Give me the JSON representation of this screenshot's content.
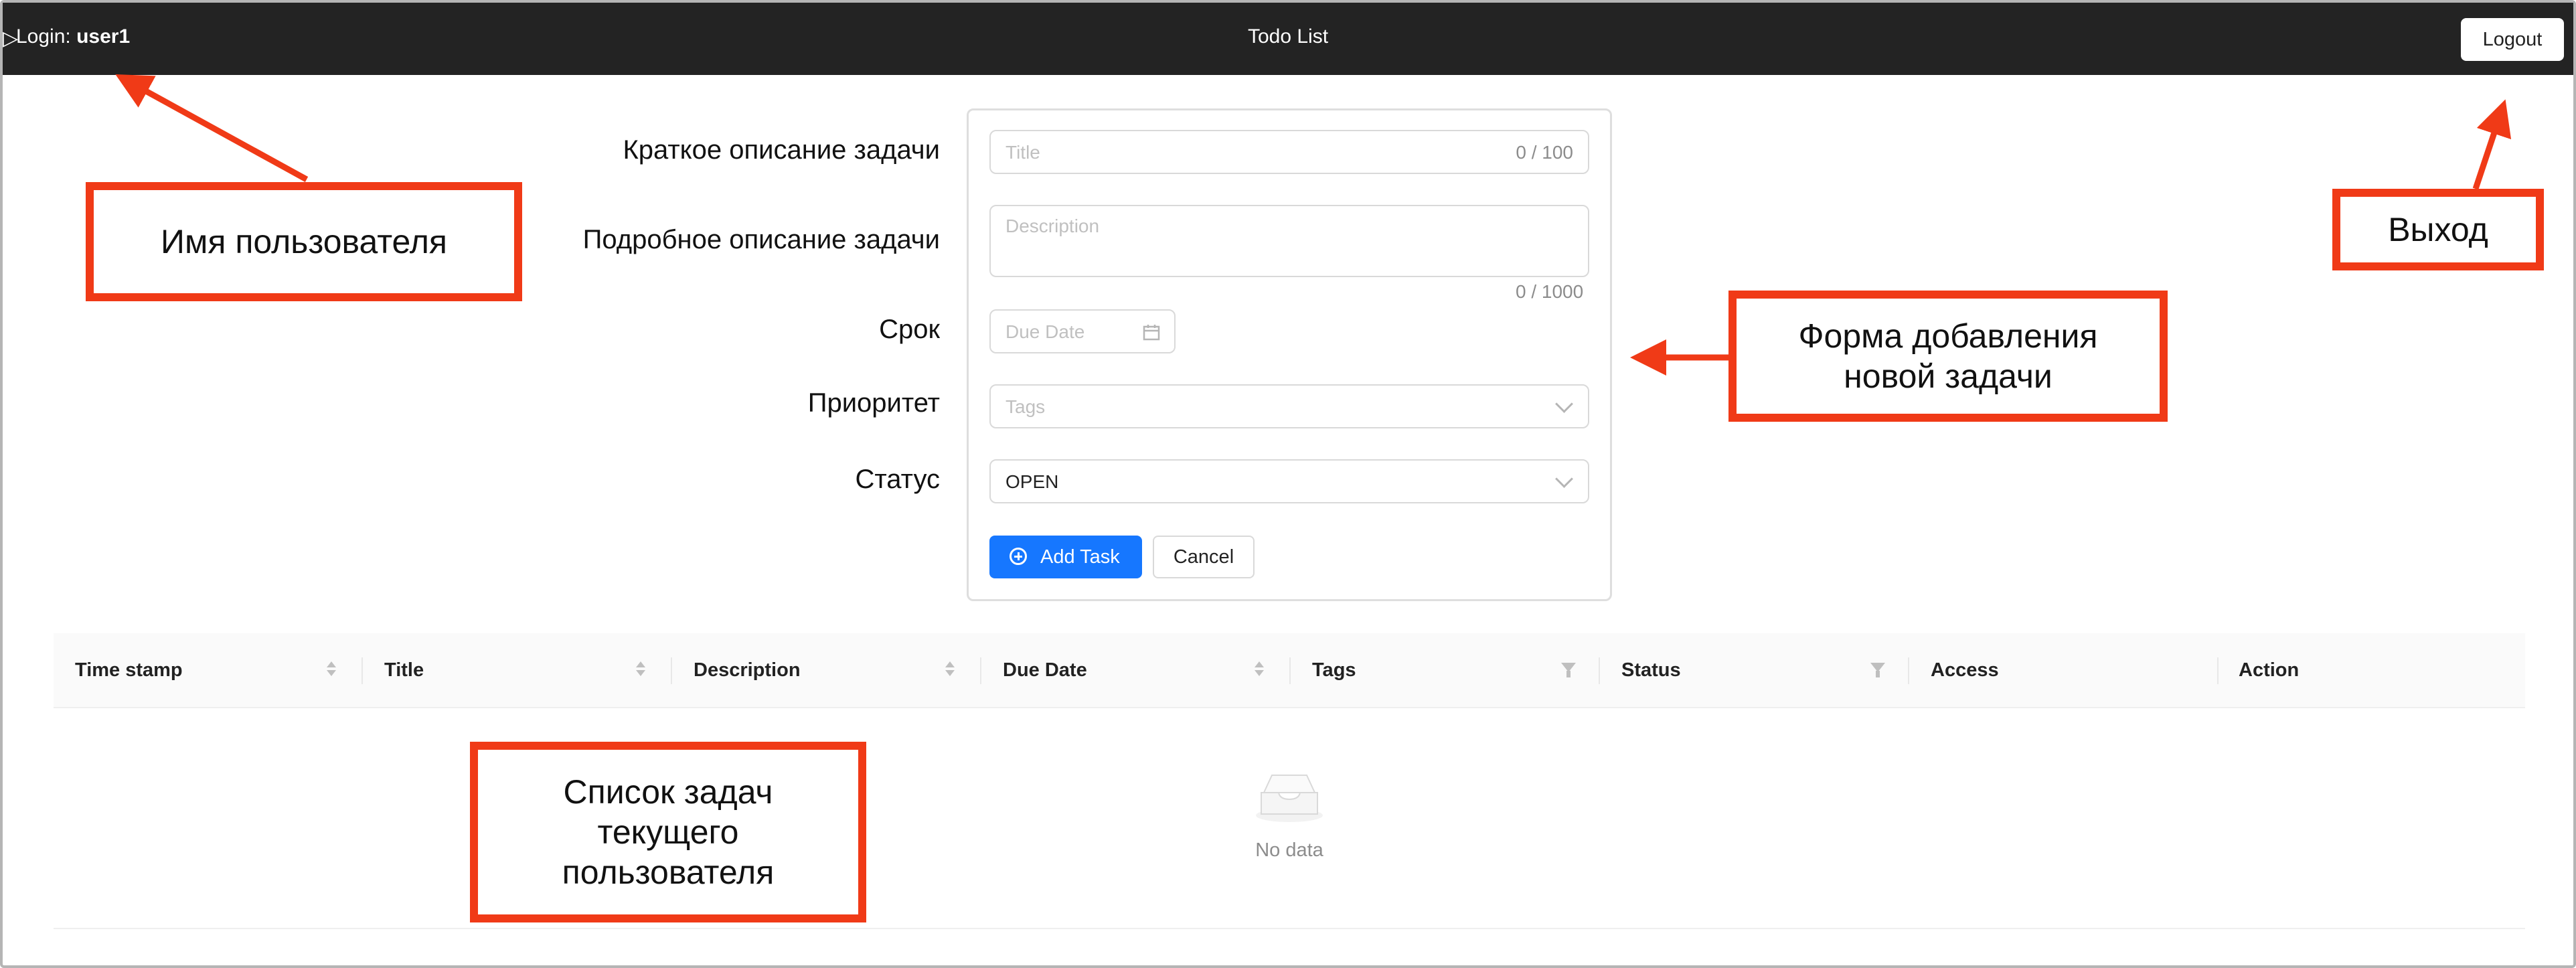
{
  "header": {
    "login_prefix": "Login: ",
    "username": "user1",
    "app_title": "Todo List",
    "logout_label": "Logout",
    "collapse_glyph": "▷"
  },
  "form": {
    "labels": {
      "title": "Краткое описание задачи",
      "description": "Подробное описание задачи",
      "due": "Срок",
      "priority": "Приоритет",
      "status": "Статус"
    },
    "title_placeholder": "Title",
    "title_counter": "0 / 100",
    "description_placeholder": "Description",
    "description_counter": "0 / 1000",
    "due_placeholder": "Due Date",
    "tags_placeholder": "Tags",
    "status_value": "OPEN",
    "add_label": "Add Task",
    "cancel_label": "Cancel"
  },
  "table": {
    "columns": [
      "Time stamp",
      "Title",
      "Description",
      "Due Date",
      "Tags",
      "Status",
      "Access",
      "Action"
    ],
    "empty_text": "No data"
  },
  "annotations": {
    "username": "Имя пользователя",
    "logout": "Выход",
    "form": "Форма добавления новой задачи",
    "list": "Список задач текущего пользователя"
  },
  "colors": {
    "topbar": "#232323",
    "primary": "#1677ff",
    "annotation": "#f03a17"
  },
  "icons": [
    "calendar-icon",
    "chevron-down-icon",
    "plus-circle-icon",
    "sort-icon",
    "filter-icon",
    "empty-box-icon"
  ]
}
